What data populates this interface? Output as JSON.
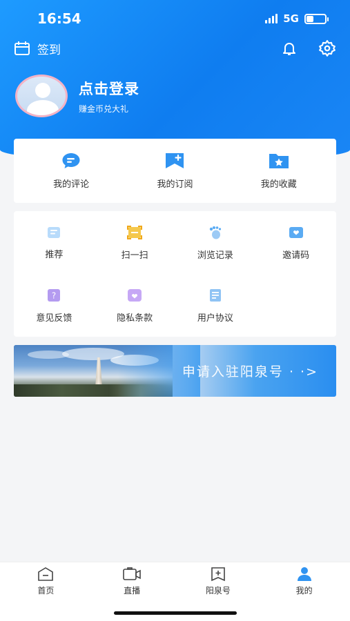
{
  "status_bar": {
    "time": "16:54",
    "network": "5G"
  },
  "header": {
    "checkin_label": "签到"
  },
  "profile": {
    "login_title": "点击登录",
    "login_subtitle": "赚金币兑大礼"
  },
  "quick_actions": [
    {
      "label": "我的评论",
      "icon": "comment-icon"
    },
    {
      "label": "我的订阅",
      "icon": "subscribe-bookmark-icon"
    },
    {
      "label": "我的收藏",
      "icon": "favorite-folder-icon"
    }
  ],
  "services": [
    {
      "label": "推荐",
      "icon": "recommend-icon"
    },
    {
      "label": "扫一扫",
      "icon": "scan-icon"
    },
    {
      "label": "浏览记录",
      "icon": "footprint-icon"
    },
    {
      "label": "邀请码",
      "icon": "invite-icon"
    },
    {
      "label": "意见反馈",
      "icon": "feedback-icon"
    },
    {
      "label": "隐私条款",
      "icon": "privacy-icon"
    },
    {
      "label": "用户协议",
      "icon": "agreement-icon"
    }
  ],
  "banner": {
    "text": "申请入驻阳泉号 · ·>"
  },
  "tabbar": [
    {
      "label": "首页",
      "icon": "home-icon",
      "active": false
    },
    {
      "label": "直播",
      "icon": "live-camera-icon",
      "active": false
    },
    {
      "label": "阳泉号",
      "icon": "yangquan-plus-icon",
      "active": false
    },
    {
      "label": "我的",
      "icon": "profile-icon",
      "active": true
    }
  ],
  "colors": {
    "brand": "#1a86f5",
    "icon_blue": "#2f93f1",
    "light_purple": "#b49bf0"
  }
}
